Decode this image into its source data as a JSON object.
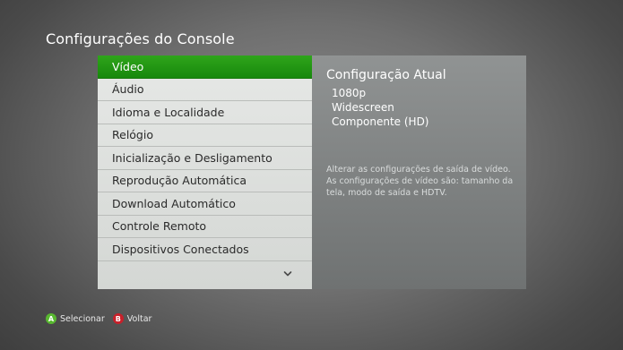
{
  "header": {
    "title": "Configurações do Console"
  },
  "menu": {
    "items": [
      {
        "label": "Vídeo",
        "selected": true
      },
      {
        "label": "Áudio"
      },
      {
        "label": "Idioma e Localidade"
      },
      {
        "label": "Relógio"
      },
      {
        "label": "Inicialização e Desligamento"
      },
      {
        "label": "Reprodução Automática"
      },
      {
        "label": "Download Automático"
      },
      {
        "label": "Controle Remoto"
      },
      {
        "label": "Dispositivos Conectados"
      }
    ],
    "more_icon": "chevron-down-icon"
  },
  "info": {
    "title": "Configuração Atual",
    "values": [
      "1080p",
      "Widescreen",
      "Componente (HD)"
    ],
    "description": "Alterar as configurações de saída de vídeo. As configurações de vídeo são: tamanho da tela, modo de saída e HDTV."
  },
  "footer": {
    "a_glyph": "A",
    "a_label": "Selecionar",
    "b_glyph": "B",
    "b_label": "Voltar"
  },
  "colors": {
    "accent_green": "#1f9a14",
    "a_button": "#58b830",
    "b_button": "#c8202a"
  }
}
